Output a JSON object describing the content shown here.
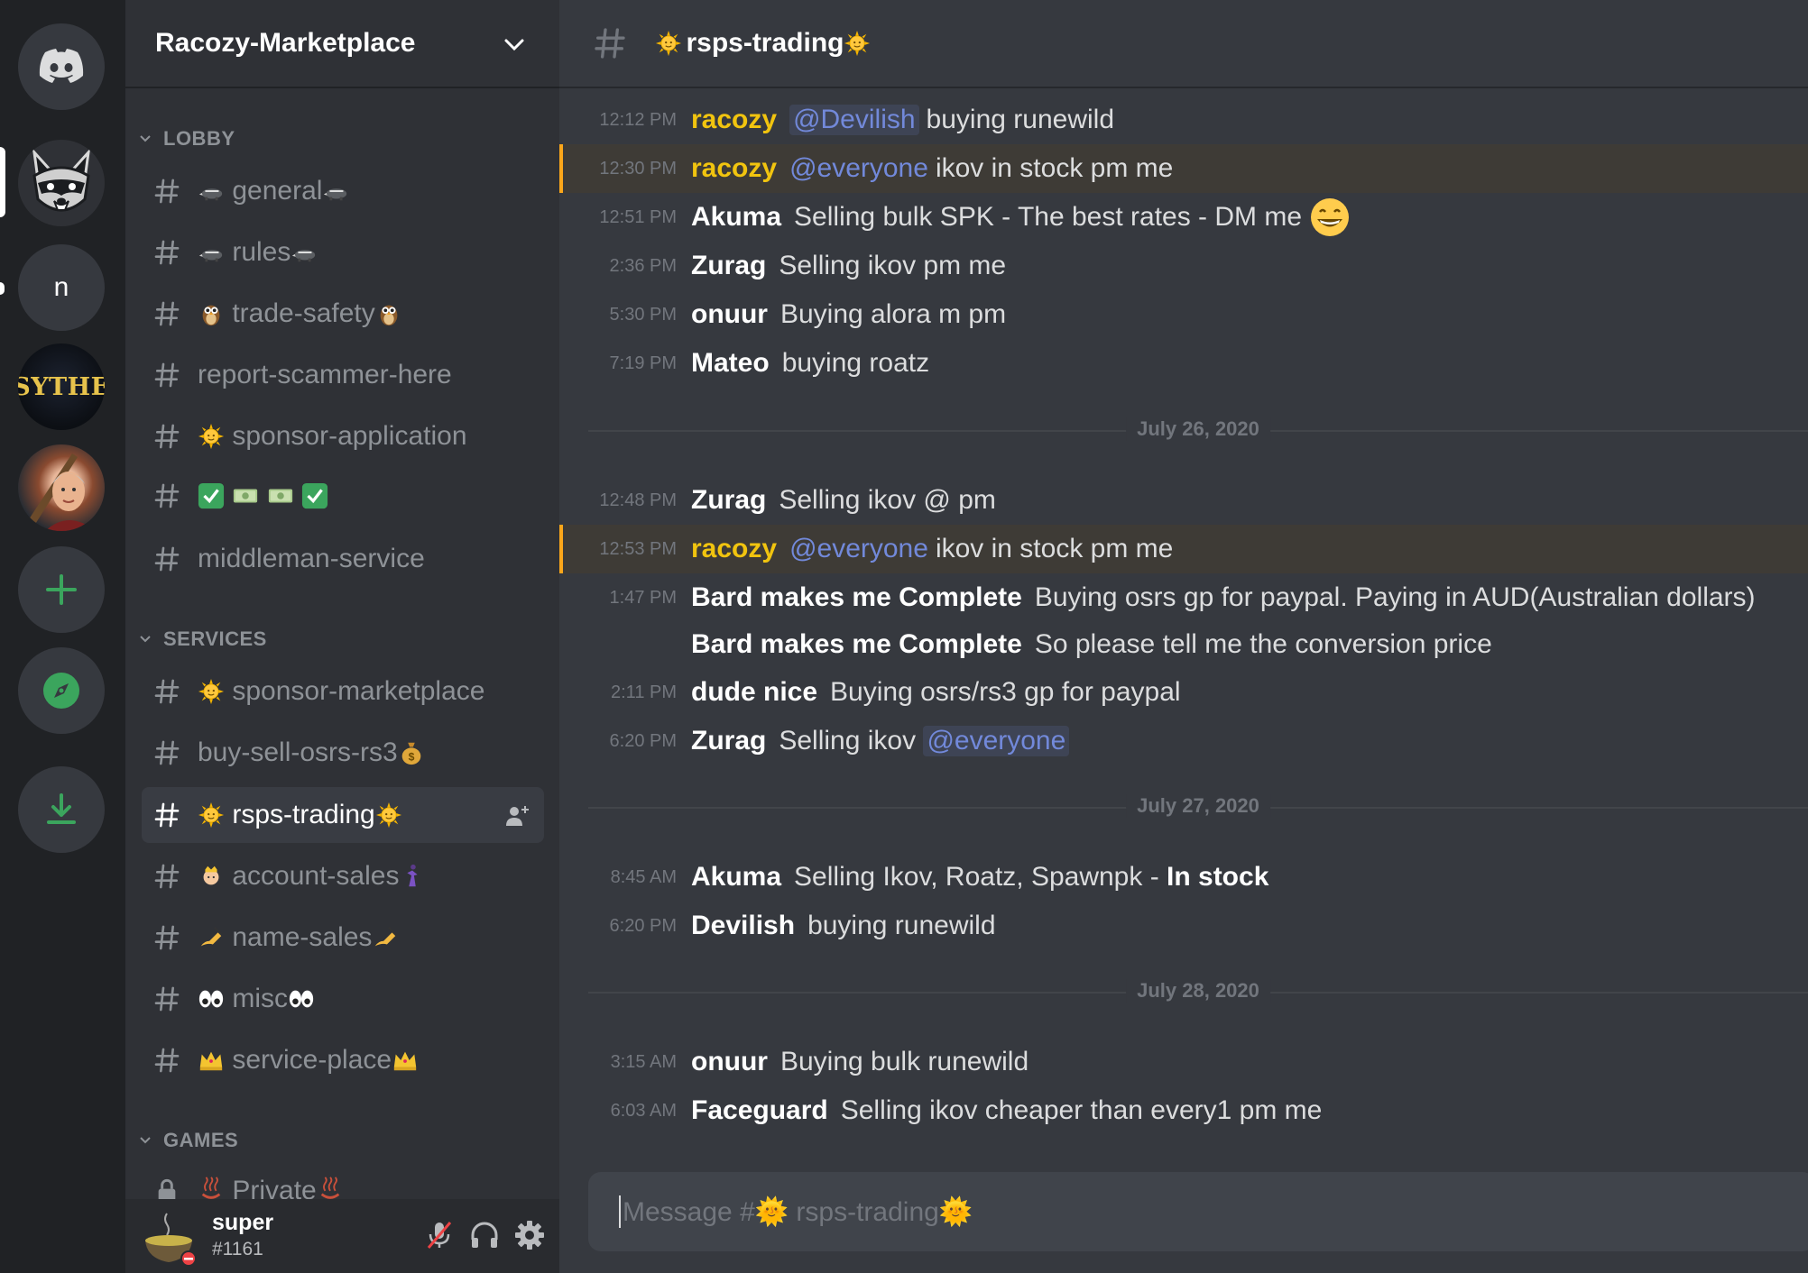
{
  "server_rail": {
    "servers": [
      {
        "name": "home",
        "icon": "discord-logo-icon"
      },
      {
        "name": "Racozy-Marketplace",
        "icon": "raccoon-icon"
      },
      {
        "name": "n",
        "initial": "n"
      },
      {
        "name": "Sythe",
        "label": "SYTHE"
      },
      {
        "name": "photo-server",
        "icon": "photo-avatar"
      },
      {
        "name": "add-server",
        "icon": "plus-icon"
      },
      {
        "name": "explore",
        "icon": "compass-icon"
      },
      {
        "name": "download",
        "icon": "download-icon"
      }
    ]
  },
  "sidebar": {
    "server_name": "Racozy-Marketplace",
    "categories": [
      {
        "label": "LOBBY",
        "channels": [
          {
            "pre": "🦡 ",
            "name": "general",
            "post": "🦡"
          },
          {
            "pre": "🦡 ",
            "name": "rules",
            "post": "🦡"
          },
          {
            "pre": "🦉 ",
            "name": "trade-safety",
            "post": "🦉"
          },
          {
            "pre": "",
            "name": "report-scammer-here",
            "post": ""
          },
          {
            "pre": "🌞 ",
            "name": "sponsor-application",
            "post": ""
          },
          {
            "pre": "",
            "name": "✅💵💵✅",
            "post": ""
          },
          {
            "pre": "",
            "name": "middleman-service",
            "post": ""
          }
        ]
      },
      {
        "label": "SERVICES",
        "channels": [
          {
            "pre": "🌞 ",
            "name": "sponsor-marketplace",
            "post": ""
          },
          {
            "pre": "",
            "name": "buy-sell-osrs-rs3",
            "post": "💰"
          },
          {
            "pre": "🌞 ",
            "name": "rsps-trading",
            "post": "🌞",
            "active": true
          },
          {
            "pre": "👸 ",
            "name": "account-sales",
            "post": "💃"
          },
          {
            "pre": "✍ ",
            "name": "name-sales",
            "post": "✍"
          },
          {
            "pre": "👀 ",
            "name": "misc",
            "post": "👀"
          },
          {
            "pre": "👑 ",
            "name": "service-place",
            "post": "👑"
          }
        ]
      },
      {
        "label": "GAMES",
        "channels": [
          {
            "pre": "♨ ",
            "name": "Private",
            "post": "♨",
            "locked": true
          }
        ]
      }
    ],
    "user": {
      "name": "super",
      "tag": "#1161"
    }
  },
  "chat": {
    "channel_title": "rsps-trading",
    "messages": [
      {
        "time": "12:12 PM",
        "author": "racozy",
        "mention": "@Devilish",
        "text": "buying runewild"
      },
      {
        "time": "12:30 PM",
        "author": "racozy",
        "mention": "@everyone",
        "text": "ikov in stock pm me"
      },
      {
        "time": "12:51 PM",
        "author": "Akuma",
        "text": "Selling bulk SPK - The best rates - DM me"
      },
      {
        "time": "2:36 PM",
        "author": "Zurag",
        "text": "Selling ikov pm me"
      },
      {
        "time": "5:30 PM",
        "author": "onuur",
        "text": "Buying alora m pm"
      },
      {
        "time": "7:19 PM",
        "author": "Mateo",
        "text": "buying roatz"
      },
      {
        "time": "12:48 PM",
        "author": "Zurag",
        "text": "Selling ikov @ pm"
      },
      {
        "time": "12:53 PM",
        "author": "racozy",
        "mention": "@everyone",
        "text": "ikov in stock pm me"
      },
      {
        "time": "1:47 PM",
        "author": "Bard makes me Complete",
        "text": "Buying osrs gp for paypal. Paying in AUD(Australian dollars)"
      },
      {
        "time": "",
        "author": "Bard makes me Complete",
        "text": "So please tell me the conversion price"
      },
      {
        "time": "2:11 PM",
        "author": "dude nice",
        "text": "Buying osrs/rs3 gp for paypal"
      },
      {
        "time": "6:20 PM",
        "author": "Zurag",
        "text": "Selling ikov",
        "mention": "@everyone"
      },
      {
        "time": "8:45 AM",
        "author": "Akuma",
        "text": "Selling Ikov, Roatz, Spawnpk - ",
        "bold": "In stock"
      },
      {
        "time": "6:20 PM",
        "author": "Devilish",
        "text": "buying runewild"
      },
      {
        "time": "3:15 AM",
        "author": "onuur",
        "text": "Buying bulk runewild"
      },
      {
        "time": "6:03 AM",
        "author": "Faceguard",
        "text": "Selling ikov cheaper than every1 pm me"
      }
    ],
    "dividers": [
      "July 26, 2020",
      "July 27, 2020",
      "July 28, 2020"
    ],
    "composer_placeholder": "Message #🌞 rsps-trading🌞"
  },
  "colors": {
    "rail_bg": "#202225",
    "sidebar_bg": "#2f3136",
    "chat_bg": "#36393f",
    "owner_name": "#f1c40f",
    "mention_blue": "#7289da",
    "mention_highlight_bar": "#faa61a",
    "green_accent": "#3ba55d"
  }
}
